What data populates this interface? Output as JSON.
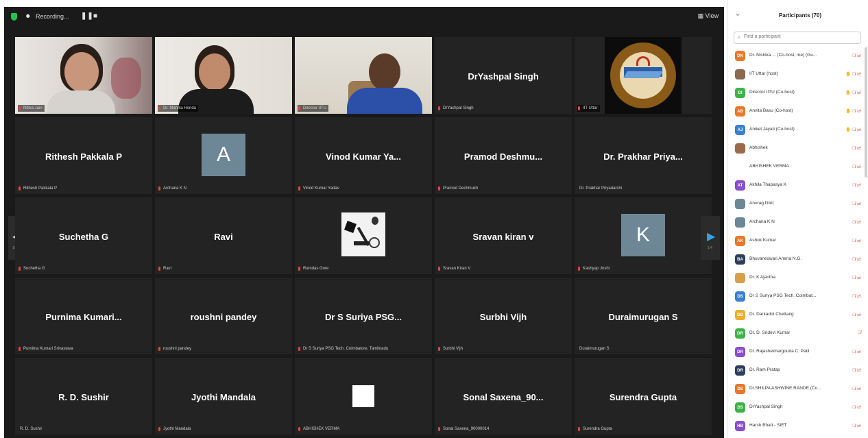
{
  "meeting": {
    "recording_label": "Recording...",
    "view_label": "View",
    "nav_left_page": "1/4",
    "nav_right_page": "1/4"
  },
  "tiles": [
    {
      "name": "",
      "label": "Nitika Jain",
      "type": "video-woman1"
    },
    {
      "name": "",
      "label": "Dr. Mahika Honda",
      "type": "video-woman2"
    },
    {
      "name": "",
      "label": "Director IITU",
      "type": "video-man",
      "active": true
    },
    {
      "name": "DrYashpal Singh",
      "label": "DrYashpal Singh",
      "type": "name"
    },
    {
      "name": "",
      "label": "IIT Uttar",
      "type": "logo"
    },
    {
      "name": "Rithesh Pakkala P",
      "label": "Rithesh Pakkala P",
      "type": "name"
    },
    {
      "name": "",
      "label": "Archana K N",
      "type": "letter",
      "letter": "A"
    },
    {
      "name": "Vinod Kumar Ya...",
      "label": "Vinod Kumar Yadav",
      "type": "name"
    },
    {
      "name": "Pramod  Deshmu...",
      "label": "Pramod Deshmukh",
      "type": "name"
    },
    {
      "name": "Dr. Prakhar Priya...",
      "label": "Dr. Prakhar Priyadarshi",
      "type": "name",
      "nomic": true
    },
    {
      "name": "Suchetha G",
      "label": "Suchetha G",
      "type": "name"
    },
    {
      "name": "Ravi",
      "label": "Ravi",
      "type": "name"
    },
    {
      "name": "",
      "label": "Ramdas Gore",
      "type": "image-art"
    },
    {
      "name": "Sravan kiran v",
      "label": "Sravan Kiran V",
      "type": "name"
    },
    {
      "name": "",
      "label": "Kashyap Joshi",
      "type": "letter",
      "letter": "K"
    },
    {
      "name": "Purnima  Kumari...",
      "label": "Purnima Kumari Srivastava",
      "type": "name"
    },
    {
      "name": "roushni pandey",
      "label": "roushni pandey",
      "type": "name"
    },
    {
      "name": "Dr S Suriya PSG...",
      "label": "Dr S Suriya PSG Tech. Coimbatore, Tamilnadu",
      "type": "name"
    },
    {
      "name": "Surbhi Vijh",
      "label": "Surbhi Vijh",
      "type": "name"
    },
    {
      "name": "Duraimurugan S",
      "label": "Duraimurugan S",
      "type": "name",
      "nomic": true
    },
    {
      "name": "R. D. Sushir",
      "label": "R. D. Sushir",
      "type": "name",
      "nomic": true
    },
    {
      "name": "Jyothi Mandala",
      "label": "Jyothi Mandala",
      "type": "name"
    },
    {
      "name": "",
      "label": "ABHISHEK VERMA",
      "type": "white-square"
    },
    {
      "name": "Sonal  Saxena_90...",
      "label": "Sonal Saxena_90000014",
      "type": "name"
    },
    {
      "name": "Surendra Gupta",
      "label": "Surendra Gupta",
      "type": "name"
    }
  ],
  "participants_panel": {
    "title": "Participants (70)",
    "search_placeholder": "Find a participant",
    "items": [
      {
        "initials": "DN",
        "color": "#e8782b",
        "name": "Dr. Nishika ... (Co-host, me) (Gu...",
        "status": "mic cam"
      },
      {
        "initials": "",
        "color": "#8a6a52",
        "name": "IIT Uttar (host)",
        "status": "host mic cam"
      },
      {
        "initials": "DI",
        "color": "#3fb24a",
        "name": "Director IITU (Co-host)",
        "status": "host mic cam"
      },
      {
        "initials": "AB",
        "color": "#e8782b",
        "name": "Anvita Basu (Co-host)",
        "status": "host mic cam"
      },
      {
        "initials": "AJ",
        "color": "#3b7fd1",
        "name": "Aniket Jayati (Co-host)",
        "status": "host mic cam"
      },
      {
        "initials": "",
        "color": "#9a6a4a",
        "name": "Abhishek",
        "status": "mic cam"
      },
      {
        "initials": "",
        "color": "#ffffff",
        "name": "ABHISHEK VERMA",
        "status": "mic cam"
      },
      {
        "initials": "AT",
        "color": "#8a4fd1",
        "name": "Akhila Thapasya K",
        "status": "mic cam"
      },
      {
        "initials": "",
        "color": "#6d8797",
        "name": "Anurag Dixit",
        "status": "mic cam"
      },
      {
        "initials": "",
        "color": "#6d8797",
        "name": "Archana K N",
        "status": "mic cam"
      },
      {
        "initials": "AK",
        "color": "#e8782b",
        "name": "Ashok Kumar",
        "status": "mic cam"
      },
      {
        "initials": "BA",
        "color": "#2e3f5c",
        "name": "Bhuvaneswari Amma N.G.",
        "status": "mic cam"
      },
      {
        "initials": "",
        "color": "#d9a04a",
        "name": "Dr. K Ajantha",
        "status": "mic cam"
      },
      {
        "initials": "DS",
        "color": "#3b7fd1",
        "name": "Dr S Suriya PSG Tech. Coimbat...",
        "status": "mic cam"
      },
      {
        "initials": "DD",
        "color": "#e8b02b",
        "name": "Dr. Darkadot Chettang",
        "status": "mic cam"
      },
      {
        "initials": "DR",
        "color": "#3fb24a",
        "name": "Dr. D. Sridevi Kumar",
        "status": "mic"
      },
      {
        "initials": "DR",
        "color": "#8a4fd1",
        "name": "Dr. Rajashekhargouda C. Patil",
        "status": "mic cam"
      },
      {
        "initials": "DR",
        "color": "#2e3f5c",
        "name": "Dr. Ram Pratap",
        "status": "mic cam"
      },
      {
        "initials": "DS",
        "color": "#e8782b",
        "name": "Dr.SHILPA ASHWINE RANDE (Co...",
        "status": "mic cam"
      },
      {
        "initials": "DS",
        "color": "#3fb24a",
        "name": "DrYashpal Singh",
        "status": "mic cam"
      },
      {
        "initials": "HB",
        "color": "#8a4fd1",
        "name": "Harsh Bhatt - SIET",
        "status": "mic cam"
      }
    ]
  }
}
